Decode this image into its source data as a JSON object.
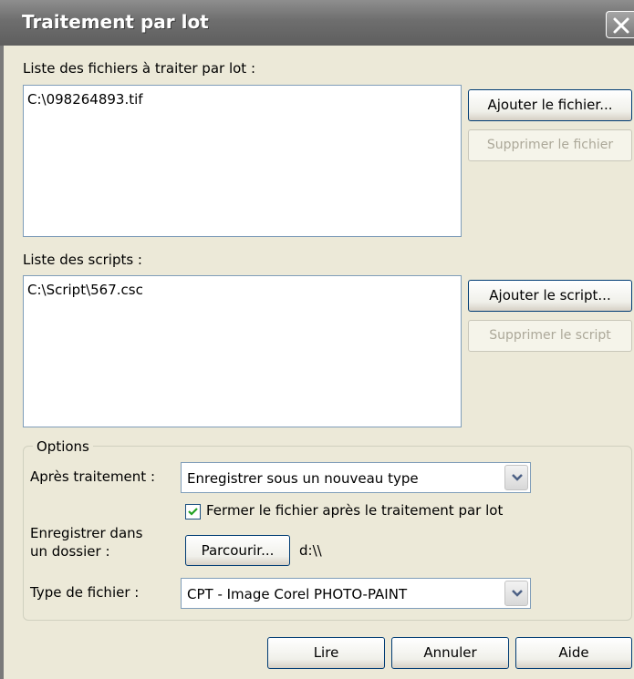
{
  "window": {
    "title": "Traitement par lot"
  },
  "files": {
    "label": "Liste des fichiers à traiter par lot :",
    "items": [
      "C:\\098264893.tif"
    ],
    "add_label": "Ajouter le fichier...",
    "remove_label": "Supprimer le fichier"
  },
  "scripts": {
    "label": "Liste des scripts :",
    "items": [
      "C:\\Script\\567.csc"
    ],
    "add_label": "Ajouter le script...",
    "remove_label": "Supprimer le script"
  },
  "options": {
    "group_label": "Options",
    "after_label": "Après traitement :",
    "after_value": "Enregistrer sous un nouveau type",
    "close_checkbox_label": "Fermer le fichier après le traitement par lot",
    "close_checked": true,
    "save_folder_label_line1": "Enregistrer dans",
    "save_folder_label_line2": "un dossier :",
    "browse_label": "Parcourir...",
    "folder_path": "d:\\\\",
    "filetype_label": "Type de fichier :",
    "filetype_value": "CPT - Image Corel PHOTO-PAINT"
  },
  "footer": {
    "run_label": "Lire",
    "cancel_label": "Annuler",
    "help_label": "Aide"
  }
}
